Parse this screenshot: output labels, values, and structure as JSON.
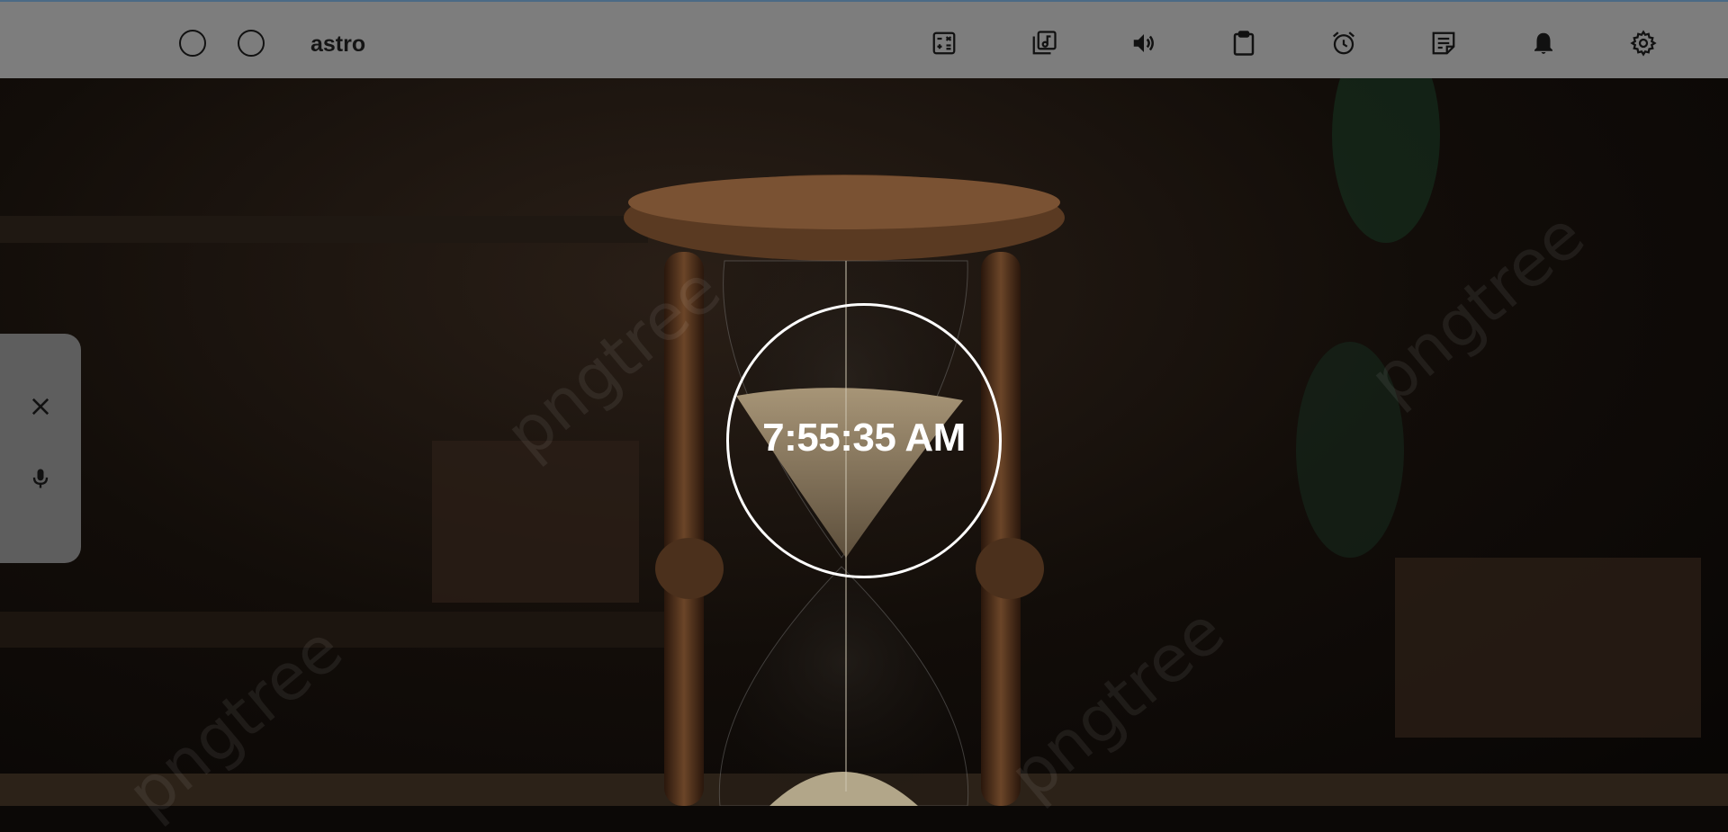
{
  "app": {
    "title": "astro"
  },
  "window_controls": [
    {
      "name": "circle-button-1"
    },
    {
      "name": "circle-button-2"
    }
  ],
  "toolbar": {
    "icons": [
      "calculator-icon",
      "music-library-icon",
      "volume-icon",
      "clipboard-icon",
      "alarm-icon",
      "notes-icon",
      "bell-icon",
      "settings-icon"
    ]
  },
  "side_panel": {
    "icons": [
      "close-icon",
      "microphone-icon"
    ]
  },
  "clock": {
    "time": "7:55:35 AM"
  },
  "background": {
    "watermark": "pngtree"
  },
  "colors": {
    "topbar": "#7d7d7d",
    "side_panel": "#5e5e5e",
    "clock": "#ffffff"
  }
}
